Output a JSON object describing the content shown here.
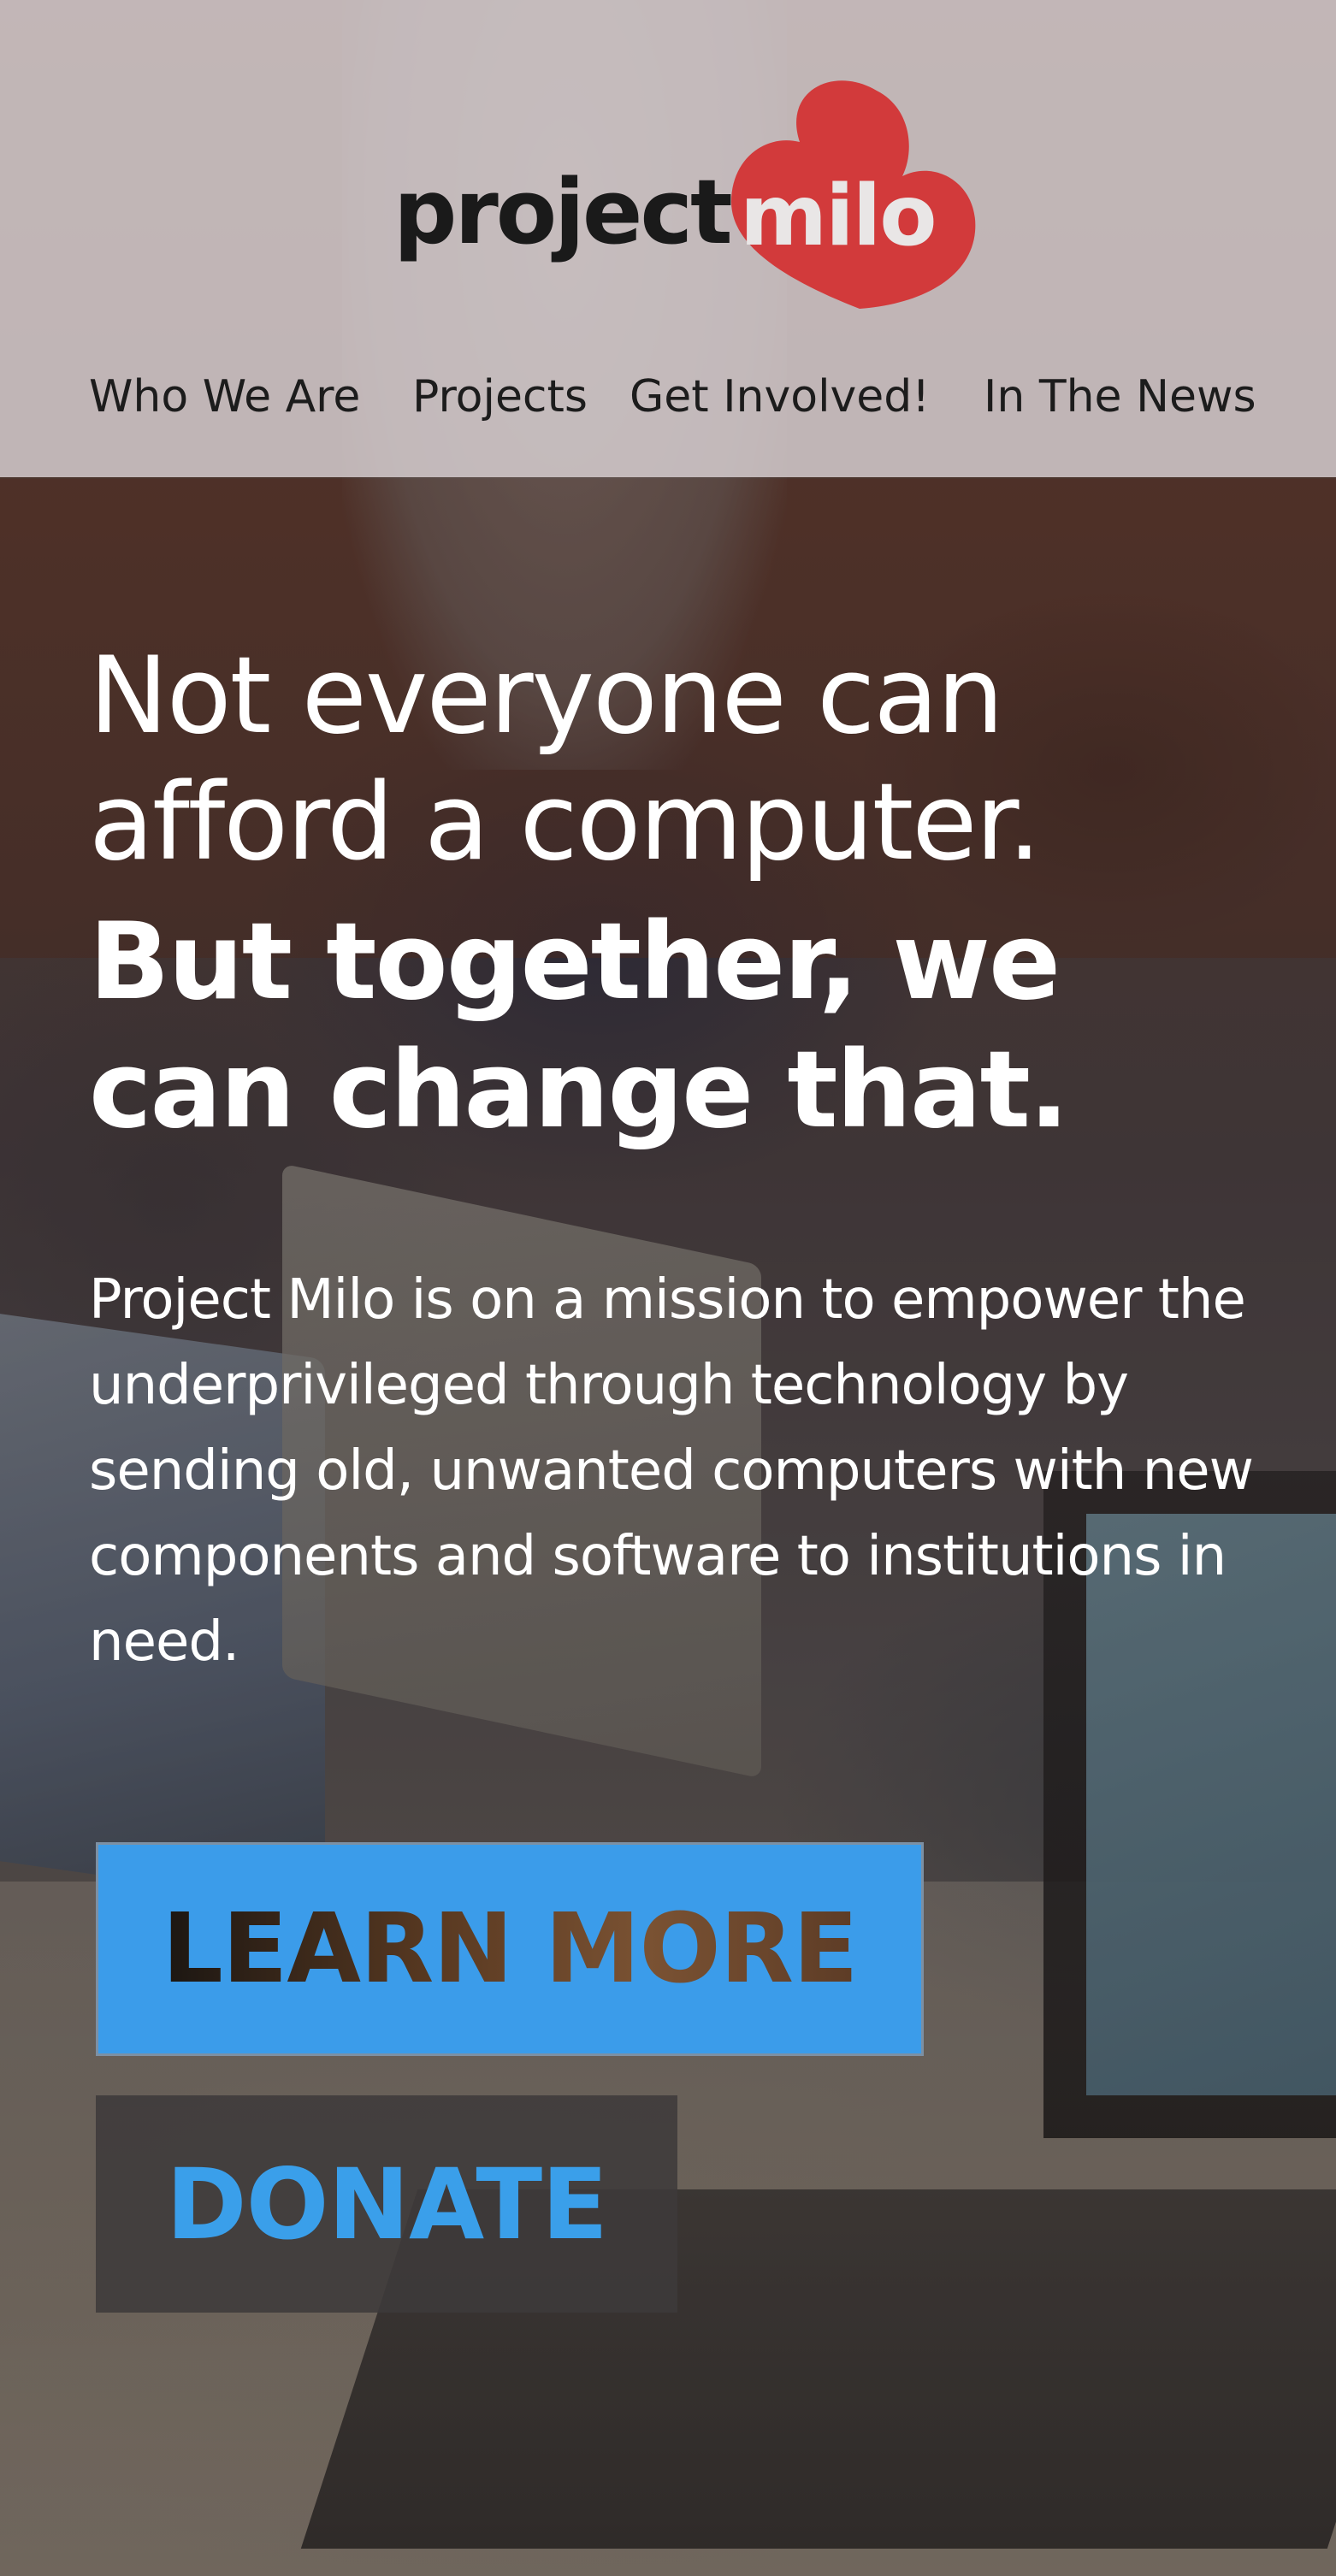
{
  "brand": {
    "word_dark": "project",
    "word_heart": "milo",
    "heart_color": "#d23a3b"
  },
  "nav": {
    "items": [
      {
        "label": "Who We Are"
      },
      {
        "label": "Projects"
      },
      {
        "label": "Get Involved!"
      },
      {
        "label": "In The News"
      }
    ]
  },
  "hero": {
    "headline": "Not everyone can afford a computer.",
    "subheadline": "But together, we can change that.",
    "body": "Project Milo is on a mission to empower the underprivileged through technology by sending old, unwanted computers with new components and software to institutions in need."
  },
  "actions": {
    "learn_more_label": "LEARN MORE",
    "donate_label": "DONATE",
    "learn_more_color": "#3b9cea",
    "donate_text_color": "#3a9fea"
  }
}
